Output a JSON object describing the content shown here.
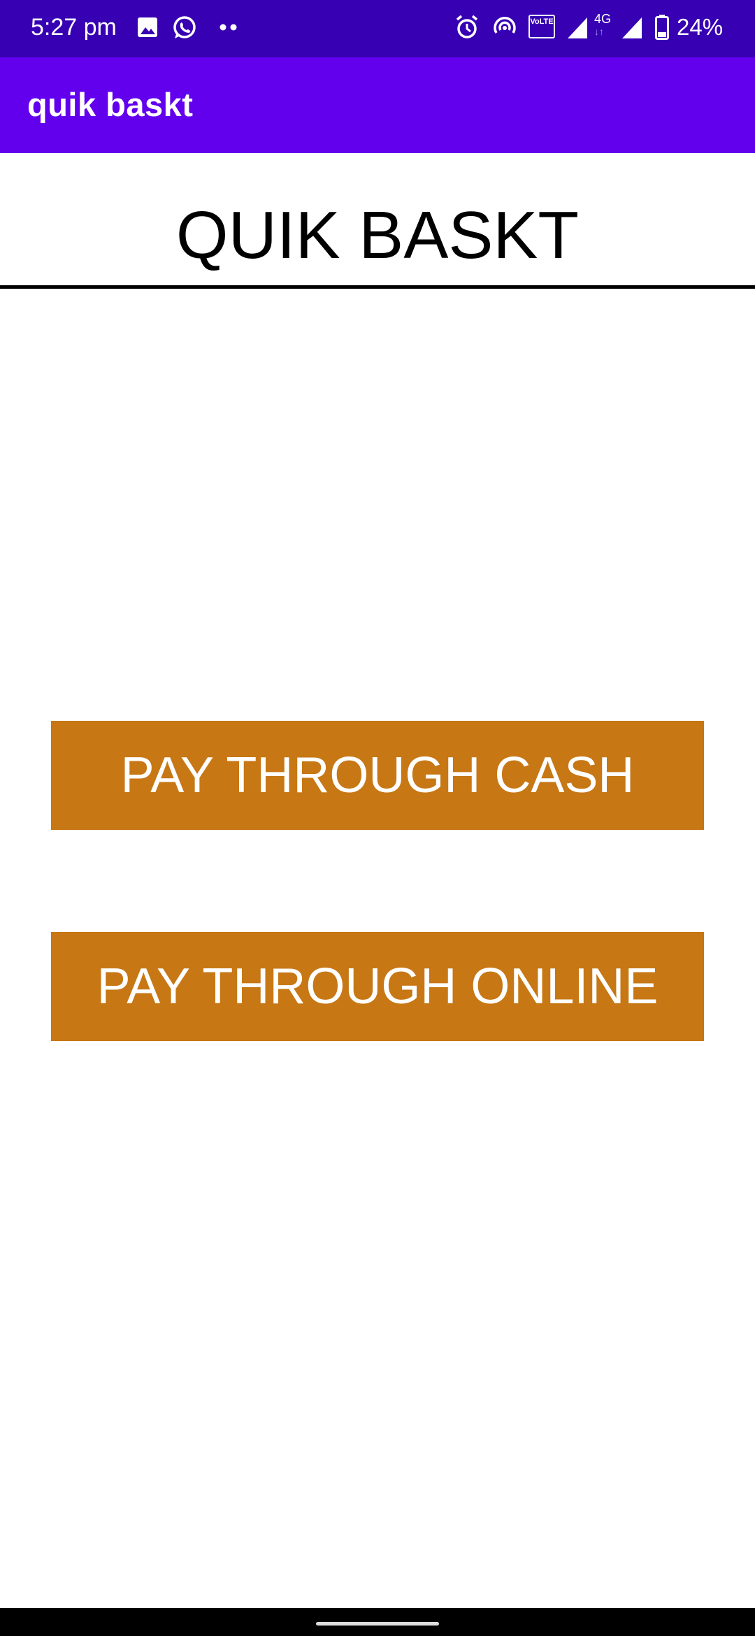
{
  "status_bar": {
    "time": "5:27 pm",
    "battery_percent": "24%",
    "volte_label": "VoLTE",
    "network_label": "4G",
    "icons": [
      "image-icon",
      "whatsapp-icon",
      "more-dots-icon",
      "alarm-icon",
      "hotspot-icon",
      "volte-icon",
      "signal-icon",
      "network-4g-icon",
      "signal-icon",
      "battery-icon"
    ]
  },
  "app_bar": {
    "title": "quik baskt"
  },
  "main": {
    "heading": "QUIK BASKT",
    "cash_button_label": "PAY THROUGH CASH",
    "online_button_label": "PAY THROUGH ONLINE"
  },
  "colors": {
    "status_bar": "#3700b3",
    "app_bar": "#6200ee",
    "button": "#c77714",
    "button_text": "#ffffff"
  }
}
